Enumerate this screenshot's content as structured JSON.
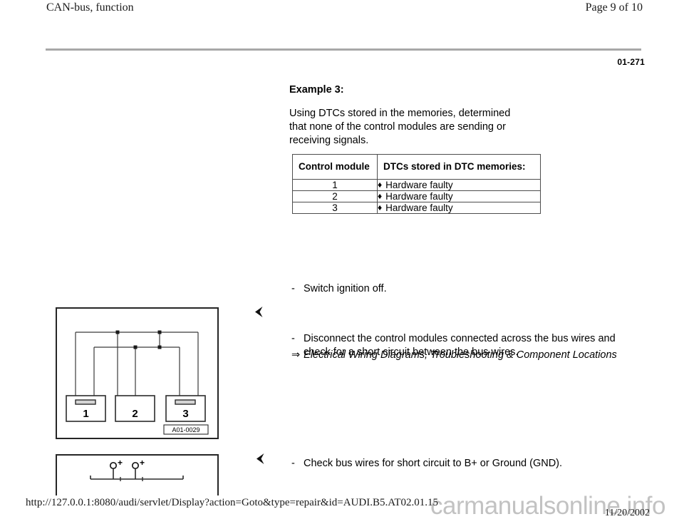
{
  "header": {
    "title": "CAN-bus, function",
    "page_label": "Page 9 of 10",
    "doc_number": "01-271"
  },
  "content": {
    "example_title": "Example 3:",
    "example_body": "Using DTCs stored in the memories, determined that none of the control modules are sending or receiving signals."
  },
  "table": {
    "headers": [
      "Control module",
      "DTCs stored in DTC memories:"
    ],
    "bullet_glyph": "♦",
    "rows": [
      {
        "module": "1",
        "dtc": "Hardware faulty"
      },
      {
        "module": "2",
        "dtc": "Hardware faulty"
      },
      {
        "module": "3",
        "dtc": "Hardware faulty"
      }
    ]
  },
  "steps": {
    "dash": "-",
    "ignition": "Switch ignition off.",
    "disconnect": "Disconnect the control modules connected across the bus wires and check for a short circuit between the bus wires.",
    "check_wires": "Check bus wires for short circuit to B+ or Ground (GND)."
  },
  "reference": {
    "arrow_glyph": "⇒",
    "text": "Electrical Wiring Diagrams, Troubleshooting & Component Locations"
  },
  "figure1": {
    "caption": "A01-0029",
    "module_labels": [
      "1",
      "2",
      "3"
    ]
  },
  "figure2": {
    "terminal_labels": [
      "+",
      "+"
    ]
  },
  "footer": {
    "url": "http://127.0.0.1:8080/audi/servlet/Display?action=Goto&type=repair&id=AUDI.B5.AT02.01.15",
    "date": "11/20/2002",
    "watermark": "carmanualsonline.info"
  },
  "colors": {
    "rule": "#a8a8a8",
    "border": "#4d4d4d",
    "figure_border": "#262626",
    "watermark": "#c2c2c2"
  }
}
